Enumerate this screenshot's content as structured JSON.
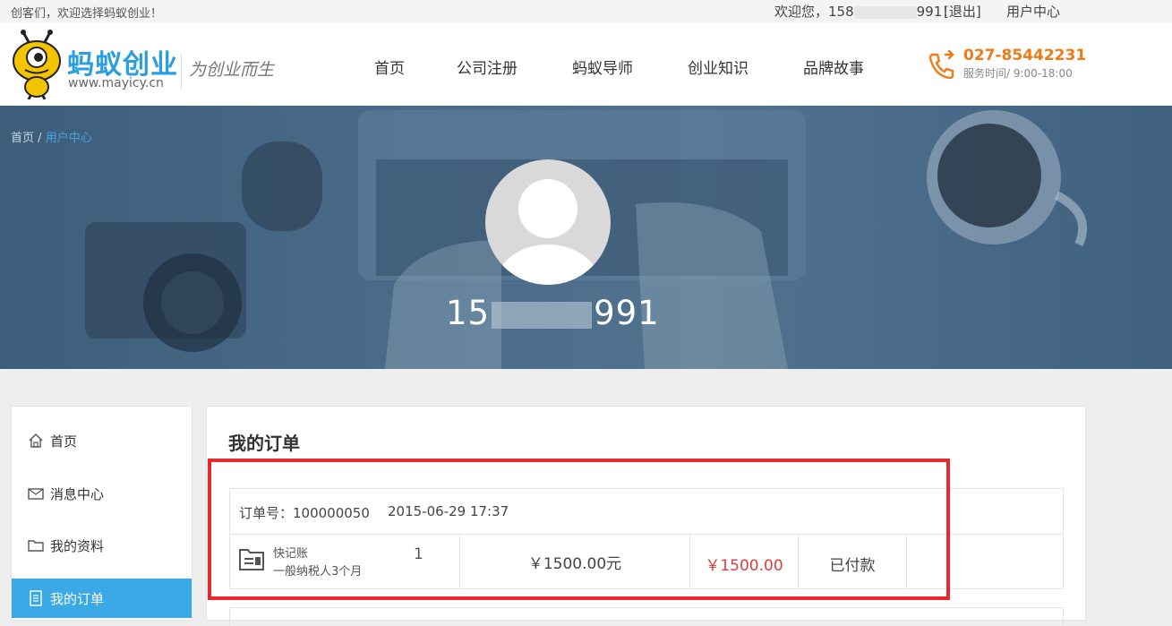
{
  "topbar": {
    "greeting": "创客们，欢迎选择蚂蚁创业！",
    "welcome_prefix": "欢迎您，158",
    "welcome_suffix": "991！",
    "logout": "[退出]",
    "user_center": "用户中心"
  },
  "header": {
    "brand": "蚂蚁创业",
    "brand_url": "www.mayicy.cn",
    "slogan": "为创业而生",
    "nav": [
      "首页",
      "公司注册",
      "蚂蚁导师",
      "创业知识",
      "品牌故事"
    ],
    "phone": "027-85442231",
    "hours": "服务时间/ 9:00-18:00"
  },
  "banner": {
    "breadcrumb_home": "首页",
    "breadcrumb_sep": "/",
    "breadcrumb_current": "用户中心",
    "username_prefix": "15",
    "username_suffix": "991"
  },
  "sidebar": {
    "items": [
      {
        "label": "首页",
        "icon": "home-icon"
      },
      {
        "label": "消息中心",
        "icon": "mail-icon"
      },
      {
        "label": "我的资料",
        "icon": "folder-icon"
      },
      {
        "label": "我的订单",
        "icon": "document-icon",
        "active": true
      }
    ]
  },
  "main": {
    "title": "我的订单",
    "order": {
      "number": "订单号：100000050",
      "datetime": "2015-06-29 17:37",
      "product_name": "快记账",
      "product_desc": "一般纳税人3个月",
      "quantity": "1",
      "price": "￥1500.00元",
      "total": "￥1500.00",
      "status": "已付款"
    }
  },
  "colors": {
    "accent": "#3ba9e6",
    "brand": "#2b9ee0",
    "phone": "#f07a17",
    "price_red": "#e4393c",
    "highlight": "#e8282e"
  }
}
